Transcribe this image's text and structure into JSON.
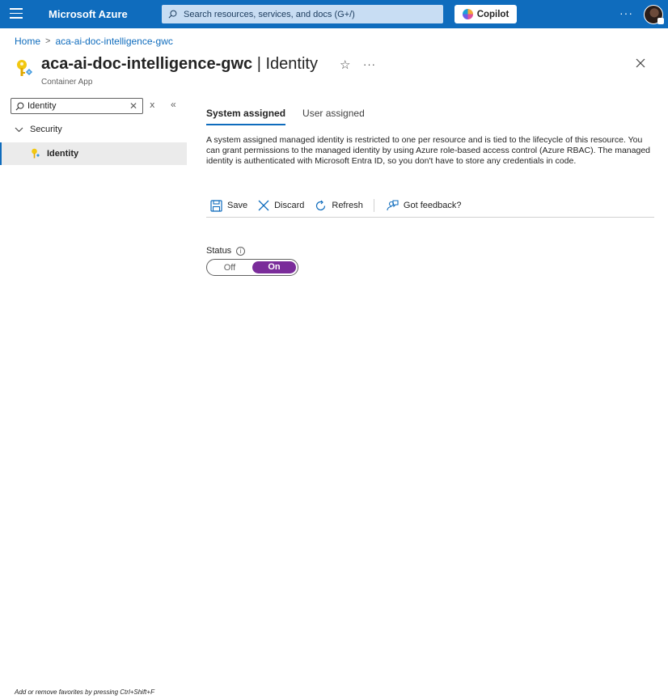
{
  "topbar": {
    "brand": "Microsoft Azure",
    "search_placeholder": "Search resources, services, and docs (G+/)",
    "copilot_label": "Copilot",
    "more_label": "···"
  },
  "breadcrumb": {
    "home": "Home",
    "separator": ">",
    "resource": "aca-ai-doc-intelligence-gwc"
  },
  "header": {
    "resource_name": "aca-ai-doc-intelligence-gwc",
    "separator": "|",
    "page_name": "Identity",
    "subtitle": "Container App",
    "star": "☆",
    "more": "···"
  },
  "nav": {
    "search_value": "Identity",
    "group_label": "Security",
    "item_label": "Identity"
  },
  "tabs": [
    {
      "label": "System assigned",
      "active": true
    },
    {
      "label": "User assigned",
      "active": false
    }
  ],
  "description": "A system assigned managed identity is restricted to one per resource and is tied to the lifecycle of this resource. You can grant permissions to the managed identity by using Azure role-based access control (Azure RBAC). The managed identity is authenticated with Microsoft Entra ID, so you don't have to store any credentials in code.",
  "toolbar": {
    "save_label": "Save",
    "discard_label": "Discard",
    "refresh_label": "Refresh",
    "feedback_label": "Got feedback?"
  },
  "status": {
    "label": "Status",
    "off_label": "Off",
    "on_label": "On",
    "value": "On"
  },
  "footer_hint": "Add or remove favorites by pressing Ctrl+Shift+F",
  "colors": {
    "topbar": "#0f6cbd",
    "accent": "#0f6cbd",
    "toggle_on": "#7a2c9a"
  }
}
